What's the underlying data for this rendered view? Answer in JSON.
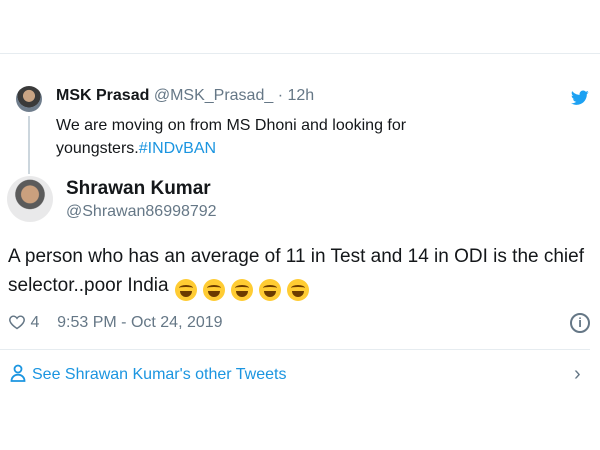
{
  "quoted_tweet": {
    "name": "MSK Prasad",
    "handle": "@MSK_Prasad_",
    "separator": "·",
    "time": "12h",
    "text": "We are moving on from MS Dhoni and looking for youngsters.",
    "hashtag": "#INDvBAN"
  },
  "tweet": {
    "author_name": "Shrawan Kumar",
    "author_handle": "@Shrawan86998792",
    "text": "A person who has an average of 11 in Test and 14 in ODI is the chief selector..poor India",
    "emoji_icons": [
      "grinning-squinting-face-icon",
      "grinning-squinting-face-icon",
      "grinning-squinting-face-icon",
      "grinning-squinting-face-icon",
      "grinning-squinting-face-icon"
    ],
    "likes": "4",
    "timestamp": "9:53 PM - Oct 24, 2019"
  },
  "footer": {
    "see_more": "See Shrawan Kumar's other Tweets"
  },
  "colors": {
    "link": "#1b95e0",
    "muted": "#657786",
    "text": "#14171a",
    "divider": "#e6ecf0"
  }
}
